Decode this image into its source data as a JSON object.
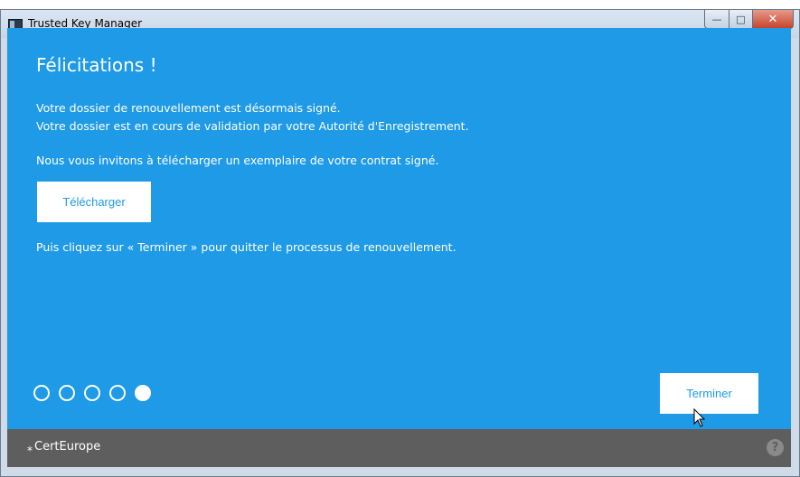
{
  "window": {
    "title": "Trusted Key Manager",
    "controls": {
      "minimize": "—",
      "maximize": "□",
      "close": "✕"
    }
  },
  "content": {
    "heading": "Félicitations !",
    "line1": "Votre dossier de renouvellement est désormais signé.",
    "line2": "Votre dossier est en cours de validation par votre Autorité d'Enregistrement.",
    "line3": "Nous vous invitons à télécharger un exemplaire de votre contrat signé.",
    "download_label": "Télécharger",
    "line4": "Puis cliquez sur « Terminer » pour quitter le processus de renouvellement.",
    "finish_label": "Terminer"
  },
  "steps": {
    "total": 5,
    "current": 5
  },
  "footer": {
    "logo_text": "CertEurope",
    "help_symbol": "?"
  },
  "colors": {
    "accent": "#1e9ae6",
    "footer": "#5e5e5e"
  }
}
